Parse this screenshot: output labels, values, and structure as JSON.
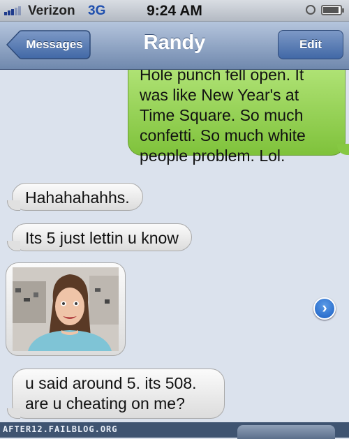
{
  "status_bar": {
    "carrier": "Verizon",
    "network": "3G",
    "time": "9:24 AM",
    "icons": [
      "signal-icon",
      "alarm-icon",
      "battery-icon"
    ],
    "battery_level": 0.9
  },
  "nav": {
    "back_label": "Messages",
    "title": "Randy",
    "edit_label": "Edit"
  },
  "messages": {
    "sent_1": "Hole punch fell open. It was like New Year's at Time Square. So much confetti. So much white people problem. Lol.",
    "recv_1": "Hahahahahhs.",
    "recv_2": "Its 5 just lettin u know",
    "recv_4": "u said around 5. its 508. are u cheating on me?"
  },
  "colors": {
    "sent_bubble": "#8fcf4c",
    "recv_bubble": "#f0f0f0",
    "background": "#dbe2ed",
    "nav_bar": "#7d94b8"
  },
  "footer": {
    "watermark": "AFTER12.FAILBLOG.ORG"
  }
}
